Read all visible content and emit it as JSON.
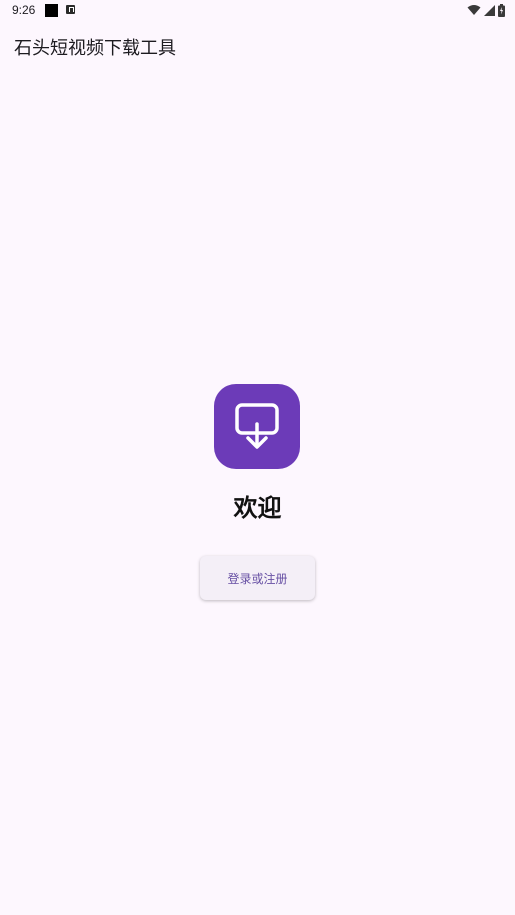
{
  "status_bar": {
    "time": "9:26",
    "icons": [
      "notification-square-icon",
      "accessibility-a-icon",
      "wifi-icon",
      "signal-icon",
      "battery-icon"
    ]
  },
  "app_bar": {
    "title": "石头短视频下载工具"
  },
  "main": {
    "app_icon": "download-screen-icon",
    "accent_color": "#6c3bb8",
    "welcome_text": "欢迎",
    "login_button_label": "登录或注册"
  },
  "colors": {
    "background": "#fdf7fe",
    "button_text": "#6750a4"
  }
}
